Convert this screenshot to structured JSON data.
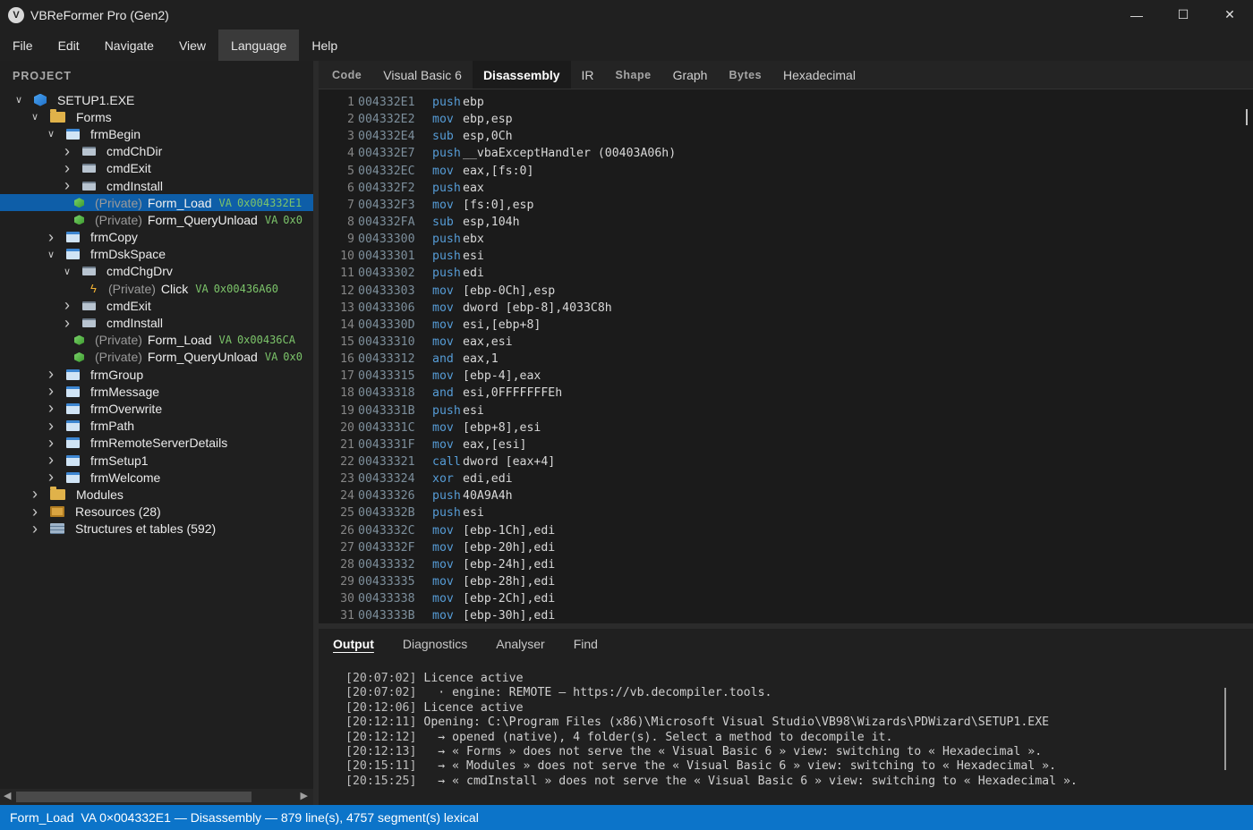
{
  "window": {
    "title": "VBReFormer Pro (Gen2)",
    "icon": "app-logo-icon"
  },
  "menu": [
    "File",
    "Edit",
    "Navigate",
    "View",
    "Language",
    "Help"
  ],
  "menu_active": "Language",
  "sidebar": {
    "header": "PROJECT",
    "tree": [
      {
        "level": 0,
        "chev": "down",
        "icon": "cube",
        "label": "SETUP1.EXE"
      },
      {
        "level": 1,
        "chev": "down",
        "icon": "folder",
        "label": "Forms"
      },
      {
        "level": 2,
        "chev": "down",
        "icon": "form",
        "label": "frmBegin"
      },
      {
        "level": 3,
        "chev": "right",
        "icon": "ctrl",
        "label": "cmdChDir"
      },
      {
        "level": 3,
        "chev": "right",
        "icon": "ctrl",
        "label": "cmdExit"
      },
      {
        "level": 3,
        "chev": "right",
        "icon": "ctrl",
        "label": "cmdInstall"
      },
      {
        "level": 3,
        "chev": "none",
        "icon": "method",
        "priv": "(Private)",
        "label": "Form_Load",
        "va": "0x004332E1",
        "selected": true
      },
      {
        "level": 3,
        "chev": "none",
        "icon": "method",
        "priv": "(Private)",
        "label": "Form_QueryUnload",
        "va": "0x0"
      },
      {
        "level": 2,
        "chev": "right",
        "icon": "form",
        "label": "frmCopy"
      },
      {
        "level": 2,
        "chev": "down",
        "icon": "form",
        "label": "frmDskSpace"
      },
      {
        "level": 3,
        "chev": "down",
        "icon": "ctrl",
        "label": "cmdChgDrv"
      },
      {
        "level": 4,
        "chev": "none",
        "icon": "bolt",
        "priv": "(Private)",
        "label": "Click",
        "va": "0x00436A60"
      },
      {
        "level": 3,
        "chev": "right",
        "icon": "ctrl",
        "label": "cmdExit"
      },
      {
        "level": 3,
        "chev": "right",
        "icon": "ctrl",
        "label": "cmdInstall"
      },
      {
        "level": 3,
        "chev": "none",
        "icon": "method",
        "priv": "(Private)",
        "label": "Form_Load",
        "va": "0x00436CA"
      },
      {
        "level": 3,
        "chev": "none",
        "icon": "method",
        "priv": "(Private)",
        "label": "Form_QueryUnload",
        "va": "0x0"
      },
      {
        "level": 2,
        "chev": "right",
        "icon": "form",
        "label": "frmGroup"
      },
      {
        "level": 2,
        "chev": "right",
        "icon": "form",
        "label": "frmMessage"
      },
      {
        "level": 2,
        "chev": "right",
        "icon": "form",
        "label": "frmOverwrite"
      },
      {
        "level": 2,
        "chev": "right",
        "icon": "form",
        "label": "frmPath"
      },
      {
        "level": 2,
        "chev": "right",
        "icon": "form",
        "label": "frmRemoteServerDetails"
      },
      {
        "level": 2,
        "chev": "right",
        "icon": "form",
        "label": "frmSetup1"
      },
      {
        "level": 2,
        "chev": "right",
        "icon": "form",
        "label": "frmWelcome"
      },
      {
        "level": 1,
        "chev": "right",
        "icon": "folder",
        "label": "Modules"
      },
      {
        "level": 1,
        "chev": "right",
        "icon": "res",
        "label": "Resources (28)"
      },
      {
        "level": 1,
        "chev": "right",
        "icon": "tbl",
        "label": "Structures et tables (592)"
      }
    ]
  },
  "editor_tabs": [
    {
      "label": "Code",
      "style": "small"
    },
    {
      "label": "Visual Basic 6",
      "style": "normal"
    },
    {
      "label": "Disassembly",
      "style": "active"
    },
    {
      "label": "IR",
      "style": "normal"
    },
    {
      "label": "Shape",
      "style": "small"
    },
    {
      "label": "Graph",
      "style": "normal"
    },
    {
      "label": "Bytes",
      "style": "small"
    },
    {
      "label": "Hexadecimal",
      "style": "normal"
    }
  ],
  "disassembly": [
    {
      "n": "1",
      "addr": "004332E1",
      "mn": "push",
      "ops": "ebp"
    },
    {
      "n": "2",
      "addr": "004332E2",
      "mn": "mov",
      "ops": "ebp,esp"
    },
    {
      "n": "3",
      "addr": "004332E4",
      "mn": "sub",
      "ops": "esp,0Ch"
    },
    {
      "n": "4",
      "addr": "004332E7",
      "mn": "push",
      "ops": "__vbaExceptHandler (00403A06h)"
    },
    {
      "n": "5",
      "addr": "004332EC",
      "mn": "mov",
      "ops": "eax,[fs:0]"
    },
    {
      "n": "6",
      "addr": "004332F2",
      "mn": "push",
      "ops": "eax"
    },
    {
      "n": "7",
      "addr": "004332F3",
      "mn": "mov",
      "ops": "[fs:0],esp"
    },
    {
      "n": "8",
      "addr": "004332FA",
      "mn": "sub",
      "ops": "esp,104h"
    },
    {
      "n": "9",
      "addr": "00433300",
      "mn": "push",
      "ops": "ebx"
    },
    {
      "n": "10",
      "addr": "00433301",
      "mn": "push",
      "ops": "esi"
    },
    {
      "n": "11",
      "addr": "00433302",
      "mn": "push",
      "ops": "edi"
    },
    {
      "n": "12",
      "addr": "00433303",
      "mn": "mov",
      "ops": "[ebp-0Ch],esp"
    },
    {
      "n": "13",
      "addr": "00433306",
      "mn": "mov",
      "ops": "dword [ebp-8],4033C8h"
    },
    {
      "n": "14",
      "addr": "0043330D",
      "mn": "mov",
      "ops": "esi,[ebp+8]"
    },
    {
      "n": "15",
      "addr": "00433310",
      "mn": "mov",
      "ops": "eax,esi"
    },
    {
      "n": "16",
      "addr": "00433312",
      "mn": "and",
      "ops": "eax,1"
    },
    {
      "n": "17",
      "addr": "00433315",
      "mn": "mov",
      "ops": "[ebp-4],eax"
    },
    {
      "n": "18",
      "addr": "00433318",
      "mn": "and",
      "ops": "esi,0FFFFFFFEh"
    },
    {
      "n": "19",
      "addr": "0043331B",
      "mn": "push",
      "ops": "esi"
    },
    {
      "n": "20",
      "addr": "0043331C",
      "mn": "mov",
      "ops": "[ebp+8],esi"
    },
    {
      "n": "21",
      "addr": "0043331F",
      "mn": "mov",
      "ops": "eax,[esi]"
    },
    {
      "n": "22",
      "addr": "00433321",
      "mn": "call",
      "ops": "dword [eax+4]"
    },
    {
      "n": "23",
      "addr": "00433324",
      "mn": "xor",
      "ops": "edi,edi"
    },
    {
      "n": "24",
      "addr": "00433326",
      "mn": "push",
      "ops": "40A9A4h"
    },
    {
      "n": "25",
      "addr": "0043332B",
      "mn": "push",
      "ops": "esi"
    },
    {
      "n": "26",
      "addr": "0043332C",
      "mn": "mov",
      "ops": "[ebp-1Ch],edi"
    },
    {
      "n": "27",
      "addr": "0043332F",
      "mn": "mov",
      "ops": "[ebp-20h],edi"
    },
    {
      "n": "28",
      "addr": "00433332",
      "mn": "mov",
      "ops": "[ebp-24h],edi"
    },
    {
      "n": "29",
      "addr": "00433335",
      "mn": "mov",
      "ops": "[ebp-28h],edi"
    },
    {
      "n": "30",
      "addr": "00433338",
      "mn": "mov",
      "ops": "[ebp-2Ch],edi"
    },
    {
      "n": "31",
      "addr": "0043333B",
      "mn": "mov",
      "ops": "[ebp-30h],edi"
    }
  ],
  "bottom_tabs": [
    {
      "label": "Output",
      "active": true
    },
    {
      "label": "Diagnostics",
      "active": false
    },
    {
      "label": "Analyser",
      "active": false
    },
    {
      "label": "Find",
      "active": false
    }
  ],
  "output": [
    {
      "ts": "[20:07:02]",
      "msg": "Licence active"
    },
    {
      "ts": "[20:07:02]",
      "msg": "  · engine: REMOTE — https://vb.decompiler.tools."
    },
    {
      "ts": "[20:12:06]",
      "msg": "Licence active"
    },
    {
      "ts": "[20:12:11]",
      "msg": "Opening: C:\\Program Files (x86)\\Microsoft Visual Studio\\VB98\\Wizards\\PDWizard\\SETUP1.EXE"
    },
    {
      "ts": "[20:12:12]",
      "msg": "  → opened (native), 4 folder(s). Select a method to decompile it."
    },
    {
      "ts": "[20:12:13]",
      "msg": "  → « Forms » does not serve the « Visual Basic 6 » view: switching to « Hexadecimal »."
    },
    {
      "ts": "[20:15:11]",
      "msg": "  → « Modules » does not serve the « Visual Basic 6 » view: switching to « Hexadecimal »."
    },
    {
      "ts": "[20:15:25]",
      "msg": "  → « cmdInstall » does not serve the « Visual Basic 6 » view: switching to « Hexadecimal »."
    }
  ],
  "status": "Form_Load  VA 0×004332E1 — Disassembly — 879 line(s), 4757 segment(s) lexical",
  "colors": {
    "accent": "#0c74c9",
    "selection": "#0e5ea8",
    "mnemonic": "#569cd6",
    "va": "#7cc46a"
  }
}
